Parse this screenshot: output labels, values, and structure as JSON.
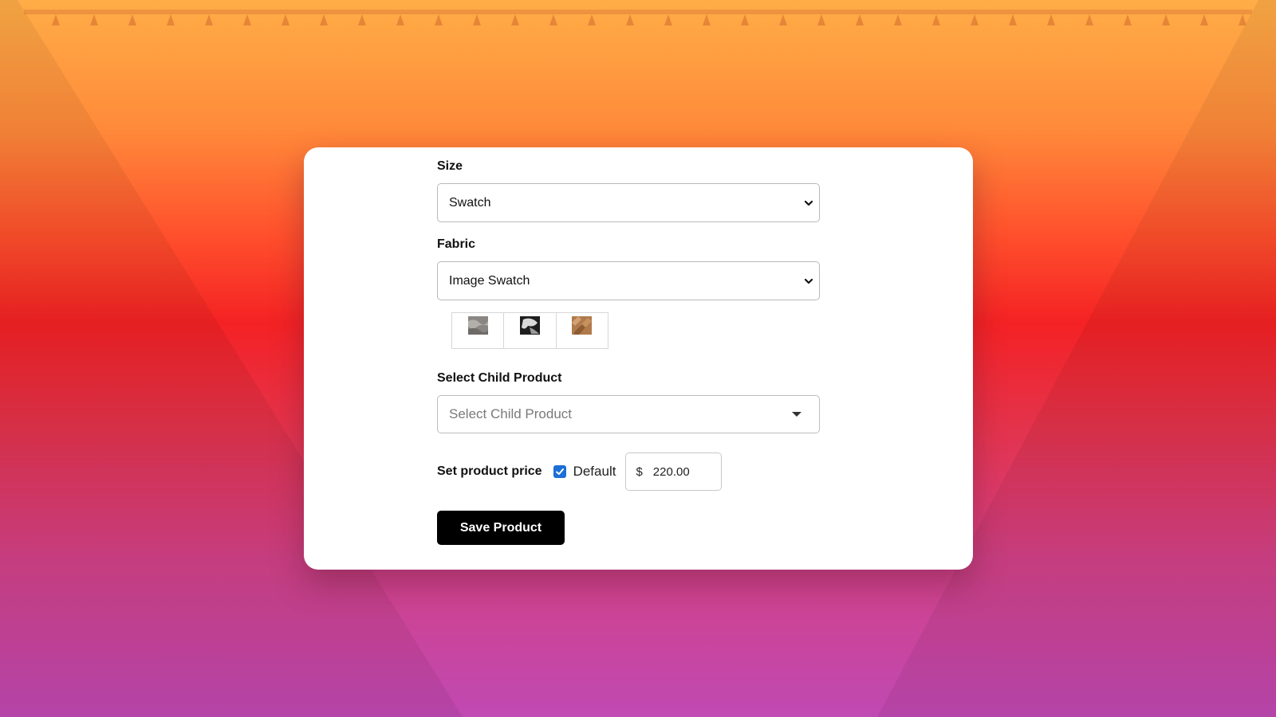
{
  "colors": {
    "accent": "#1c6fd6",
    "button_bg": "#000000",
    "button_text": "#ffffff",
    "card_bg": "#ffffff"
  },
  "form": {
    "size": {
      "label": "Size",
      "selected": "Swatch",
      "icon": "chevron-down-icon"
    },
    "fabric": {
      "label": "Fabric",
      "selected": "Image Swatch",
      "icon": "chevron-down-icon",
      "swatches": [
        {
          "name": "grey-fabric-swatch"
        },
        {
          "name": "black-white-fabric-swatch"
        },
        {
          "name": "tan-fabric-swatch"
        }
      ]
    },
    "child_product": {
      "label": "Select Child Product",
      "placeholder": "Select Child Product",
      "icon": "caret-down-icon"
    },
    "price": {
      "label": "Set product price",
      "default_checked": true,
      "default_label": "Default",
      "currency": "$",
      "value": "220.00"
    },
    "save_label": "Save Product"
  }
}
